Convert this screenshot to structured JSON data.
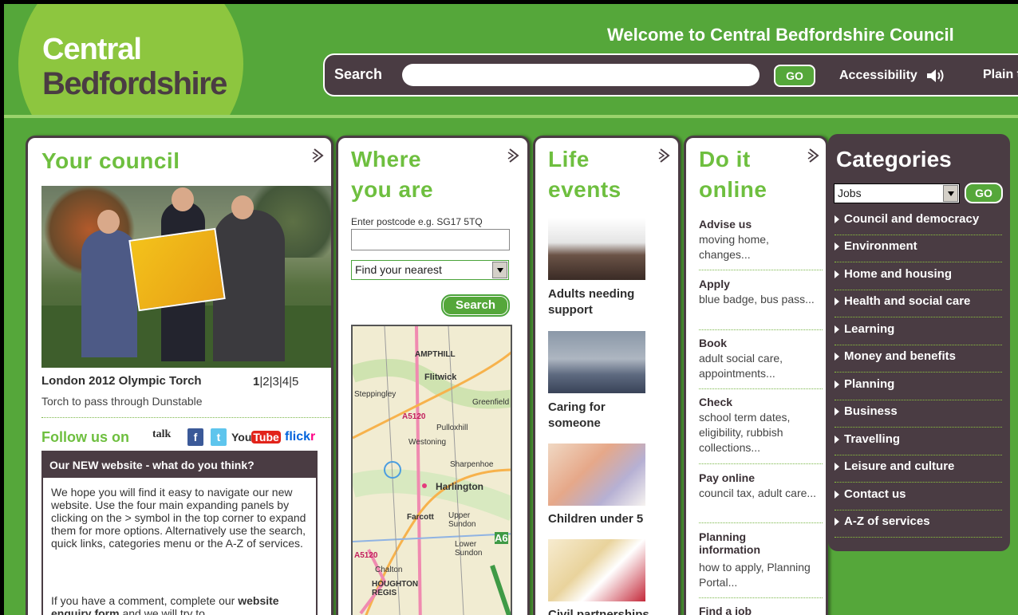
{
  "header": {
    "logo_line1": "Central",
    "logo_line2": "Bedfordshire",
    "welcome": "Welcome to Central Bedfordshire Council",
    "search_label": "Search",
    "go_label": "GO",
    "accessibility": "Accessibility",
    "plain": "Plain t"
  },
  "your_council": {
    "title": "Your council",
    "slide_title": "London 2012 Olympic Torch",
    "slide_pages": [
      "1",
      "2",
      "3",
      "4",
      "5"
    ],
    "slide_sub": "Torch to pass through Dunstable",
    "follow": "Follow us on",
    "social": {
      "talk": "talk",
      "fb": "f",
      "tw": "t",
      "yt_you": "You",
      "yt_tube": "Tube",
      "flickr1": "flick",
      "flickr2": "r"
    },
    "feedback_title": "Our NEW website - what do you think?",
    "feedback_body": "We hope you will find it easy to navigate our new website. Use the four main expanding panels by clicking on the > symbol in the top corner to expand them for more options. Alternatively use the search, quick links, categories menu or the A-Z of services.",
    "feedback_body2_a": "If you have a comment, complete our ",
    "feedback_link": "website enquiry form",
    "feedback_body2_b": " and we will try to"
  },
  "where_you_are": {
    "title_line1": "Where",
    "title_line2": "you are",
    "postcode_label": "Enter postcode e.g. SG17 5TQ",
    "find_select": "Find your nearest",
    "search_button": "Search",
    "map_labels": [
      "AMPTHILL",
      "Flitwick",
      "Steppingley",
      "Greenfield",
      "A5120",
      "Pulloxhill",
      "Westoning",
      "Harlington",
      "Sharpenhoe",
      "Farcott",
      "Upper Sundon",
      "Lower Sundon",
      "A6",
      "Chalton",
      "HOUGHTON REGIS",
      "A5120"
    ]
  },
  "life_events": {
    "title_line1": "Life",
    "title_line2": "events",
    "items": [
      {
        "label": "Adults needing support"
      },
      {
        "label": "Caring for someone"
      },
      {
        "label": "Children under 5"
      },
      {
        "label": "Civil partnerships"
      }
    ]
  },
  "do_it_online": {
    "title_line1": "Do it",
    "title_line2": "online",
    "items": [
      {
        "head": "Advise us",
        "text": "moving home, changes..."
      },
      {
        "head": "Apply",
        "text": "blue badge, bus pass..."
      },
      {
        "head": "Book",
        "text": "adult social care, appointments..."
      },
      {
        "head": "Check",
        "text": "school term dates, eligibility, rubbish collections..."
      },
      {
        "head": "Pay online",
        "text": "council tax, adult care..."
      },
      {
        "head": "Planning information",
        "text": "how to apply, Planning Portal..."
      },
      {
        "head": "Find a job",
        "text": ""
      }
    ]
  },
  "categories": {
    "title": "Categories",
    "select_value": "Jobs",
    "go_label": "GO",
    "items": [
      "Council and democracy",
      "Environment",
      "Home and housing",
      "Health and social care",
      "Learning",
      "Money and benefits",
      "Planning",
      "Business",
      "Travelling",
      "Leisure and culture",
      "Contact us",
      "A-Z of services"
    ]
  }
}
